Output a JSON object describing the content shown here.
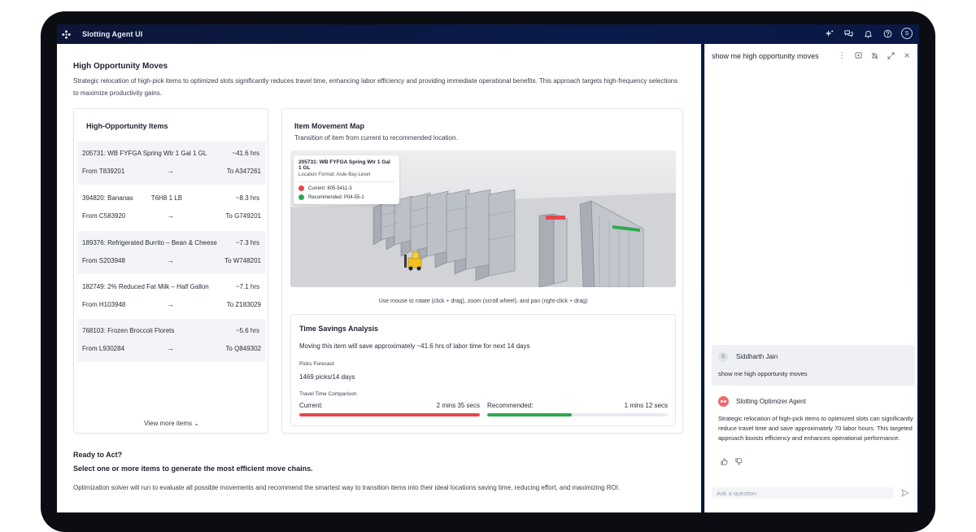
{
  "app": {
    "title": "Slotting Agent UI"
  },
  "section": {
    "title": "High Opportunity Moves",
    "description": "Strategic relocation of high-pick items to optimized slots significantly reduces travel time, enhancing labor efficiency and providing immediate operational benefits. This approach targets high-frequency selections to maximize productivity gains."
  },
  "items_panel": {
    "title": "High-Opportunity Items",
    "items": [
      {
        "name": "205731: WB FYFGA Spring Wtr 1 Gal 1 GL",
        "hours": "~41.6 hrs",
        "from": "From T839201",
        "arrow": "→",
        "to": "To A347261"
      },
      {
        "name": "394820: Bananas          T6H8 1 LB",
        "hours": "~8.3 hrs",
        "from": "From C583920",
        "arrow": "→",
        "to": "To G749201"
      },
      {
        "name": "189376: Refrigerated Burrito – Bean & Cheese",
        "hours": "~7.3 hrs",
        "from": "From S203948",
        "arrow": "→",
        "to": "To W748201"
      },
      {
        "name": "182749: 2% Reduced Fat Milk – Half Gallon",
        "hours": "~7.1 hrs",
        "from": "From H103948",
        "arrow": "→",
        "to": "To Z183029"
      },
      {
        "name": "768103: Frozen Broccoli Florets",
        "hours": "~5.6 hrs",
        "from": "From L930284",
        "arrow": "→",
        "to": "To Q849302"
      }
    ],
    "view_more": "View more items ⌄"
  },
  "map": {
    "title": "Item Movement Map",
    "subtitle": "Transition of item from current to recommended location.",
    "tooltip": {
      "item": "205731: WB FYFGA Spring Wtr 1 Gal 1 GL",
      "format": "Location Format: Aisle-Bay-Level",
      "current": "Current: 805-5411-3",
      "recommended": "Recommended: P04-55-1"
    },
    "hint": "Use mouse to rotate (click + drag), zoom (scroll wheel), and pan (right-click + drag)"
  },
  "time_savings": {
    "title": "Time Savings Analysis",
    "description": "Moving this item will save approximately ~41.6 hrs of labor time for next 14 days",
    "picks_label": "Picks Forecast",
    "picks_value": "1469 picks/14 days",
    "travel_label": "Travel Time Comparison",
    "current_label": "Current:",
    "current_value": "2 mins 35 secs",
    "current_fraction": 1.0,
    "recommended_label": "Recommended:",
    "recommended_value": "1 mins 12 secs",
    "recommended_fraction": 0.47
  },
  "ready": {
    "title": "Ready to Act?",
    "subtitle": "Select one or more items to generate the most efficient move chains.",
    "description": "Optimization solver will run to evaluate all possible movements and recommend the smartest way to transition items into their ideal locations saving time, reducing effort, and maximizing ROI."
  },
  "chat": {
    "header": "show me high opportunity moves",
    "user": {
      "initial": "S",
      "name": "Siddharth Jain",
      "message": "show me high opportunity moves"
    },
    "agent": {
      "name": "Slotting Optimizer Agent",
      "message": "Strategic relocation of high-pick items to optimized slots can significantly reduce travel time and save approximately 70 labor hours. This targeted approach boosts efficiency and enhances operational performance."
    },
    "input_placeholder": "Ask a question"
  },
  "user_avatar_initial": "S",
  "colors": {
    "current": "#e5484d",
    "recommended": "#2fa84f",
    "accent": "#0b1638"
  }
}
